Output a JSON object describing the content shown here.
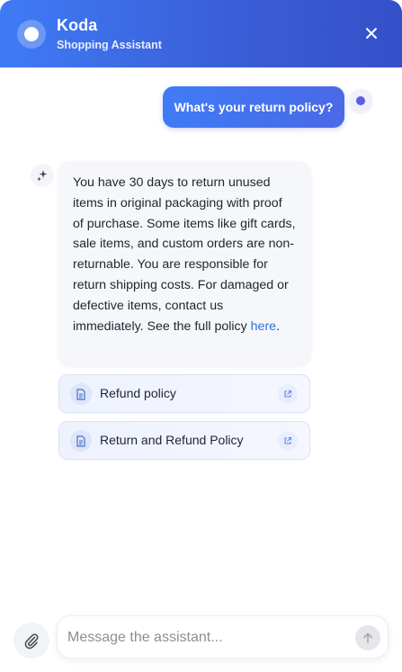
{
  "header": {
    "title": "Koda",
    "subtitle": "Shopping Assistant",
    "close_icon": "close-icon",
    "accent_start": "#3f7bf6",
    "accent_end": "#3450c8"
  },
  "messages": {
    "user": {
      "text": "What's your return policy?"
    },
    "bot": {
      "text": "You have 30 days to return unused items in original packaging with proof of purchase. Some items like gift cards, sale items, and custom orders are non-returnable. You are responsible for return shipping costs. For damaged or defective items, contact us immediately. See the full policy ",
      "link_text": "here",
      "text_end": ".",
      "link_color": "#2f6fdd"
    }
  },
  "sources": [
    {
      "label": "Refund policy",
      "icon": "document-icon",
      "action_icon": "external-link-icon"
    },
    {
      "label": "Return and Refund Policy",
      "icon": "document-icon",
      "action_icon": "external-link-icon"
    }
  ],
  "composer": {
    "placeholder": "Message the assistant...",
    "value": "",
    "attach_icon": "paperclip-icon",
    "send_icon": "arrow-up-icon"
  }
}
